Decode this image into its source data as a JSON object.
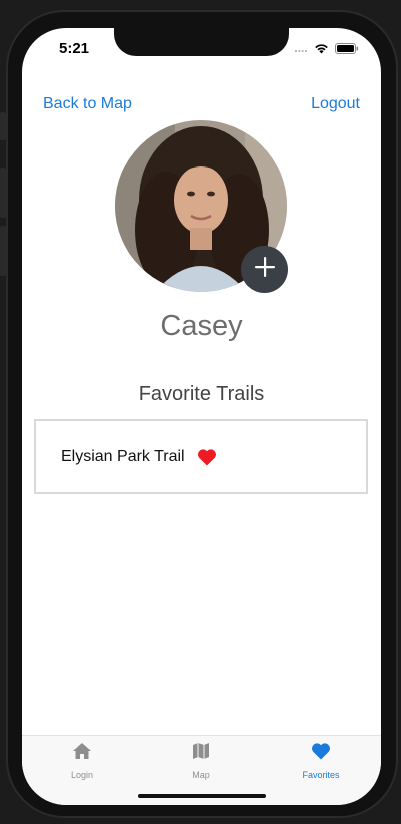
{
  "status_bar": {
    "time": "5:21"
  },
  "nav": {
    "back_label": "Back to Map",
    "logout_label": "Logout"
  },
  "profile": {
    "name": "Casey",
    "avatar_icon": "profile-photo",
    "add_icon": "plus-icon"
  },
  "favorites": {
    "title": "Favorite Trails",
    "items": [
      {
        "name": "Elysian Park Trail",
        "icon": "heart-icon"
      }
    ]
  },
  "tabbar": {
    "tabs": [
      {
        "label": "Login",
        "icon": "home-icon",
        "active": false
      },
      {
        "label": "Map",
        "icon": "map-icon",
        "active": false
      },
      {
        "label": "Favorites",
        "icon": "heart-icon",
        "active": true
      }
    ]
  },
  "colors": {
    "accent": "#1a7bdc",
    "heart": "#ee1b24",
    "add_button": "#3b3f46"
  }
}
